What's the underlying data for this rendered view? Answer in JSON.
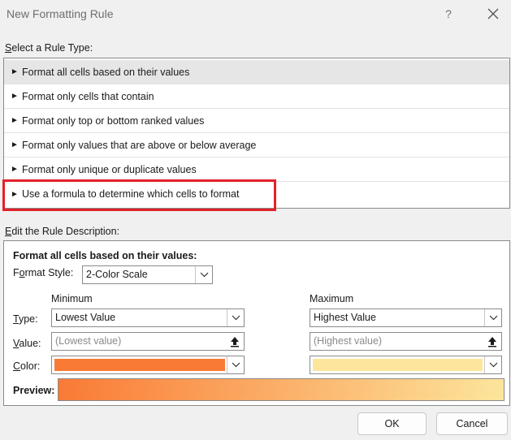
{
  "window": {
    "title": "New Formatting Rule",
    "help": "?"
  },
  "rule_type": {
    "label_u": "S",
    "label_rest": "elect a Rule Type:",
    "items": [
      "Format all cells based on their values",
      "Format only cells that contain",
      "Format only top or bottom ranked values",
      "Format only values that are above or below average",
      "Format only unique or duplicate values",
      "Use a formula to determine which cells to format"
    ],
    "bullet": "►"
  },
  "description": {
    "label_u": "E",
    "label_rest": "dit the Rule Description:",
    "heading": "Format all cells based on their values:",
    "format_style_label_pre": "F",
    "format_style_label_u": "o",
    "format_style_label_post": "rmat Style:",
    "format_style_value": "2-Color Scale",
    "minimum": {
      "header": "Minimum",
      "type": "Lowest Value",
      "value_placeholder": "(Lowest value)",
      "color": "#f97a35"
    },
    "maximum": {
      "header": "Maximum",
      "type": "Highest Value",
      "value_placeholder": "(Highest value)",
      "color": "#fde59c"
    },
    "type_label_u": "T",
    "type_label_rest": "ype:",
    "value_label_u": "V",
    "value_label_rest": "alue:",
    "color_label_u": "C",
    "color_label_rest": "olor:",
    "preview_label": "Preview:"
  },
  "buttons": {
    "ok": "OK",
    "cancel": "Cancel"
  }
}
